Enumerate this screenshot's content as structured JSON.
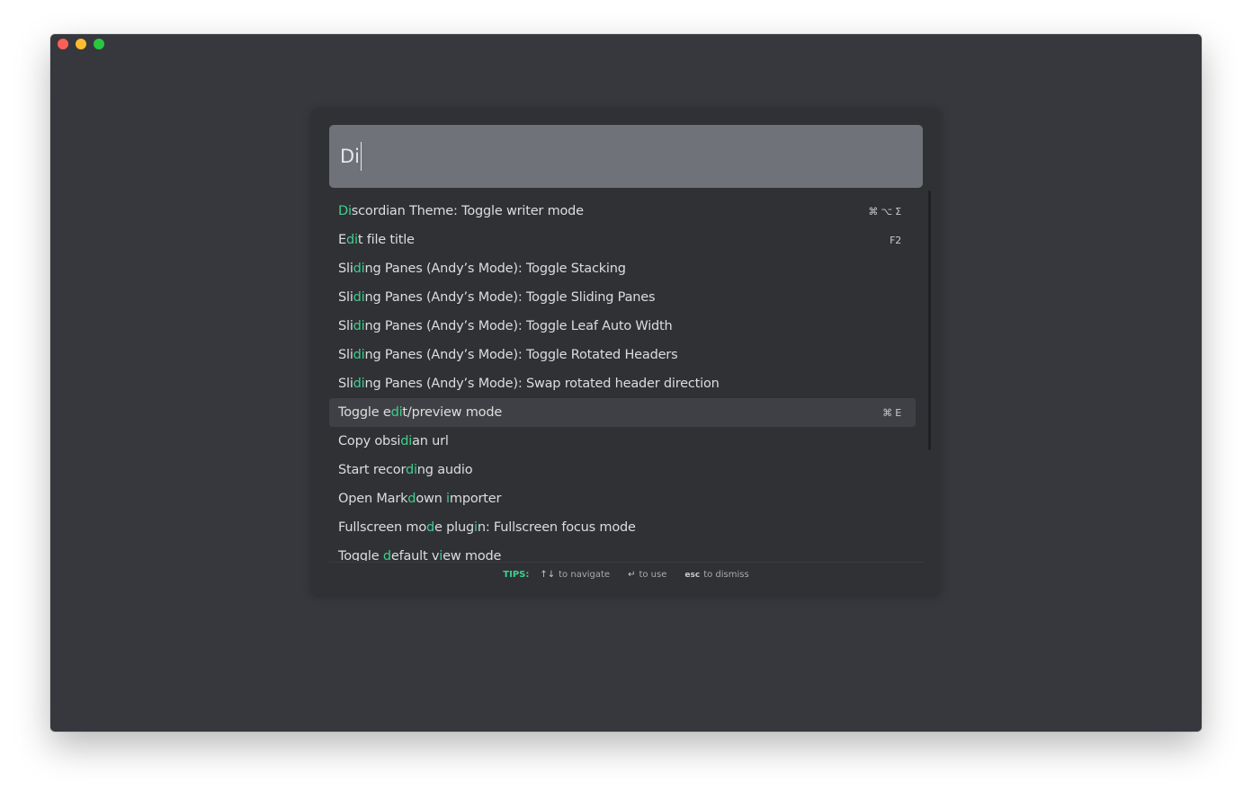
{
  "window": {
    "traffic_lights": [
      {
        "name": "close-button",
        "color": "#ff5f57"
      },
      {
        "name": "minimize-button",
        "color": "#febc2e"
      },
      {
        "name": "zoom-button",
        "color": "#28c840"
      }
    ]
  },
  "palette": {
    "search": {
      "value": "Di"
    },
    "highlight_color": "#3ecf8e",
    "results": [
      {
        "segments": [
          {
            "t": "Di",
            "h": true
          },
          {
            "t": "scordian Theme: Toggle writer mode",
            "h": false
          }
        ],
        "hotkey": "⌘ ⌥ Σ",
        "selected": false
      },
      {
        "segments": [
          {
            "t": "E",
            "h": false
          },
          {
            "t": "di",
            "h": true
          },
          {
            "t": "t file title",
            "h": false
          }
        ],
        "hotkey": "F2",
        "selected": false
      },
      {
        "segments": [
          {
            "t": "Sli",
            "h": false
          },
          {
            "t": "di",
            "h": true
          },
          {
            "t": "ng Panes (Andy’s Mode): Toggle Stacking",
            "h": false
          }
        ],
        "hotkey": "",
        "selected": false
      },
      {
        "segments": [
          {
            "t": "Sli",
            "h": false
          },
          {
            "t": "di",
            "h": true
          },
          {
            "t": "ng Panes (Andy’s Mode): Toggle Sliding Panes",
            "h": false
          }
        ],
        "hotkey": "",
        "selected": false
      },
      {
        "segments": [
          {
            "t": "Sli",
            "h": false
          },
          {
            "t": "di",
            "h": true
          },
          {
            "t": "ng Panes (Andy’s Mode): Toggle Leaf Auto Width",
            "h": false
          }
        ],
        "hotkey": "",
        "selected": false
      },
      {
        "segments": [
          {
            "t": "Sli",
            "h": false
          },
          {
            "t": "di",
            "h": true
          },
          {
            "t": "ng Panes (Andy’s Mode): Toggle Rotated Headers",
            "h": false
          }
        ],
        "hotkey": "",
        "selected": false
      },
      {
        "segments": [
          {
            "t": "Sli",
            "h": false
          },
          {
            "t": "di",
            "h": true
          },
          {
            "t": "ng Panes (Andy’s Mode): Swap rotated header direction",
            "h": false
          }
        ],
        "hotkey": "",
        "selected": false
      },
      {
        "segments": [
          {
            "t": "Toggle e",
            "h": false
          },
          {
            "t": "di",
            "h": true
          },
          {
            "t": "t/preview mode",
            "h": false
          }
        ],
        "hotkey": "⌘ E",
        "selected": true
      },
      {
        "segments": [
          {
            "t": "Copy obsi",
            "h": false
          },
          {
            "t": "di",
            "h": true
          },
          {
            "t": "an url",
            "h": false
          }
        ],
        "hotkey": "",
        "selected": false
      },
      {
        "segments": [
          {
            "t": "Start recor",
            "h": false
          },
          {
            "t": "di",
            "h": true
          },
          {
            "t": "ng audio",
            "h": false
          }
        ],
        "hotkey": "",
        "selected": false
      },
      {
        "segments": [
          {
            "t": "Open Mark",
            "h": false
          },
          {
            "t": "d",
            "h": true
          },
          {
            "t": "own ",
            "h": false
          },
          {
            "t": "i",
            "h": true
          },
          {
            "t": "mporter",
            "h": false
          }
        ],
        "hotkey": "",
        "selected": false
      },
      {
        "segments": [
          {
            "t": "Fullscreen mo",
            "h": false
          },
          {
            "t": "d",
            "h": true
          },
          {
            "t": "e plug",
            "h": false
          },
          {
            "t": "i",
            "h": true
          },
          {
            "t": "n: Fullscreen focus mode",
            "h": false
          }
        ],
        "hotkey": "",
        "selected": false
      },
      {
        "segments": [
          {
            "t": "Toggle ",
            "h": false
          },
          {
            "t": "d",
            "h": true
          },
          {
            "t": "efault v",
            "h": false
          },
          {
            "t": "i",
            "h": true
          },
          {
            "t": "ew mode",
            "h": false
          }
        ],
        "hotkey": "",
        "selected": false
      }
    ],
    "tips": {
      "title": "TIPS:",
      "items": [
        {
          "key": "↑↓",
          "text": "to navigate",
          "name": "tip-navigate"
        },
        {
          "key": "↵",
          "text": "to use",
          "name": "tip-use"
        },
        {
          "key": "esc",
          "text": "to dismiss",
          "name": "tip-dismiss"
        }
      ]
    }
  }
}
